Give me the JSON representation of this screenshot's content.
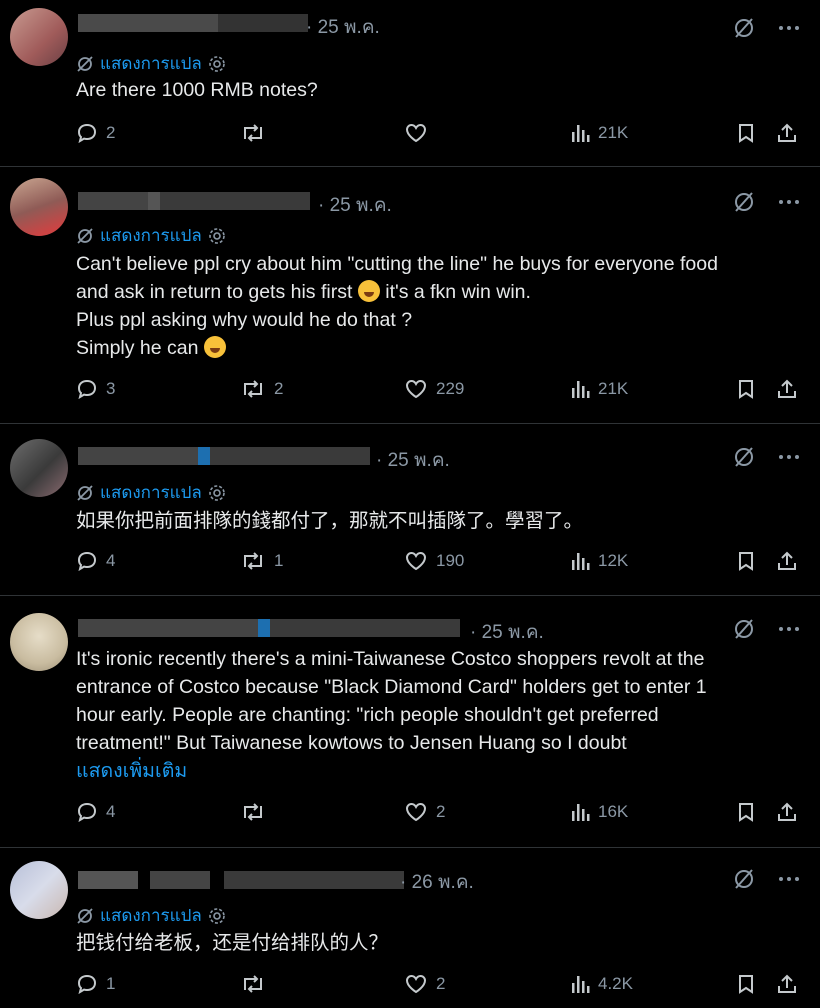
{
  "common": {
    "translate_label": "แสดงการแปล",
    "show_more_label": "แสดงเพิ่มเติม"
  },
  "tweets": [
    {
      "date": "· 25 พ.ค.",
      "lines": [
        "Are there 1000 RMB notes?"
      ],
      "replies": "2",
      "retweets": "",
      "likes": "",
      "views": "21K",
      "show_more": false
    },
    {
      "date": "· 25 พ.ค.",
      "lines": [
        "Can't believe ppl cry about him \"cutting the line\" he buys for everyone food",
        "and ask in return to gets his first",
        "it's a fkn win win.",
        "Plus ppl asking why would he do that ?",
        "Simply he can"
      ],
      "replies": "3",
      "retweets": "2",
      "likes": "229",
      "views": "21K",
      "show_more": false
    },
    {
      "date": "· 25 พ.ค.",
      "lines": [
        "如果你把前面排隊的錢都付了，那就不叫插隊了。學習了。"
      ],
      "replies": "4",
      "retweets": "1",
      "likes": "190",
      "views": "12K",
      "show_more": false
    },
    {
      "date": "· 25 พ.ค.",
      "lines": [
        "It's ironic recently there's a mini-Taiwanese Costco shoppers revolt at the",
        "entrance of Costco because \"Black Diamond Card\" holders get to enter 1",
        "hour early.  People are chanting: \"rich people shouldn't get preferred",
        "treatment!\"  But Taiwanese kowtows to Jensen Huang so I doubt"
      ],
      "replies": "4",
      "retweets": "",
      "likes": "2",
      "views": "16K",
      "show_more": true
    },
    {
      "date": "· 26 พ.ค.",
      "lines": [
        "把钱付给老板，还是付给排队的人？"
      ],
      "replies": "1",
      "retweets": "",
      "likes": "2",
      "views": "4.2K",
      "show_more": false
    }
  ]
}
